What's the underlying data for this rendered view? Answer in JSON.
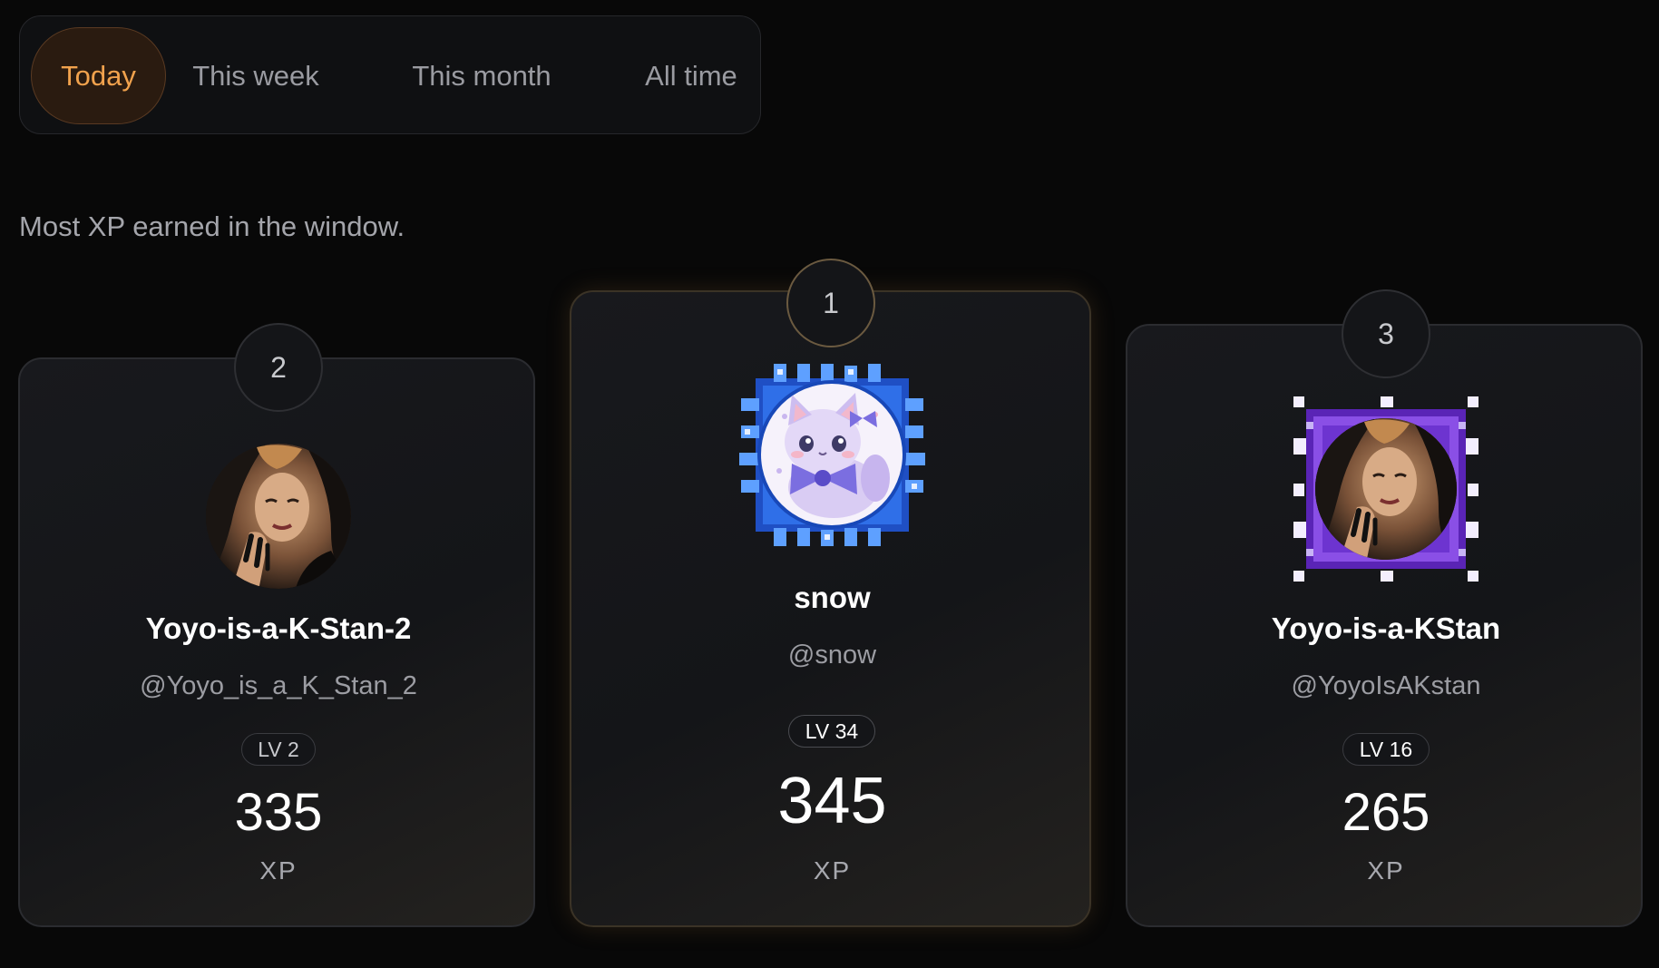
{
  "tabs": [
    {
      "label": "Today",
      "active": true
    },
    {
      "label": "This week",
      "active": false
    },
    {
      "label": "This month",
      "active": false
    },
    {
      "label": "All time",
      "active": false
    }
  ],
  "subtitle": "Most XP earned in the window.",
  "podium": [
    {
      "rank": "1",
      "name": "snow",
      "handle": "@snow",
      "level": "LV 34",
      "xp": "345",
      "xp_unit": "XP",
      "avatar": "cat-with-bow-icon",
      "frame": "blue-pixel-frame"
    },
    {
      "rank": "2",
      "name": "Yoyo-is-a-K-Stan-2",
      "handle": "@Yoyo_is_a_K_Stan_2",
      "level": "LV 2",
      "xp": "335",
      "xp_unit": "XP",
      "avatar": "user-photo-avatar",
      "frame": "none"
    },
    {
      "rank": "3",
      "name": "Yoyo-is-a-KStan",
      "handle": "@YoyoIsAKstan",
      "level": "LV 16",
      "xp": "265",
      "xp_unit": "XP",
      "avatar": "user-photo-avatar",
      "frame": "purple-pixel-frame"
    }
  ],
  "colors": {
    "accent": "#f1a24d",
    "background": "#080808",
    "card": "#16171a",
    "frame_blue": "#2f6fe8",
    "frame_purple": "#7c3ae0"
  }
}
